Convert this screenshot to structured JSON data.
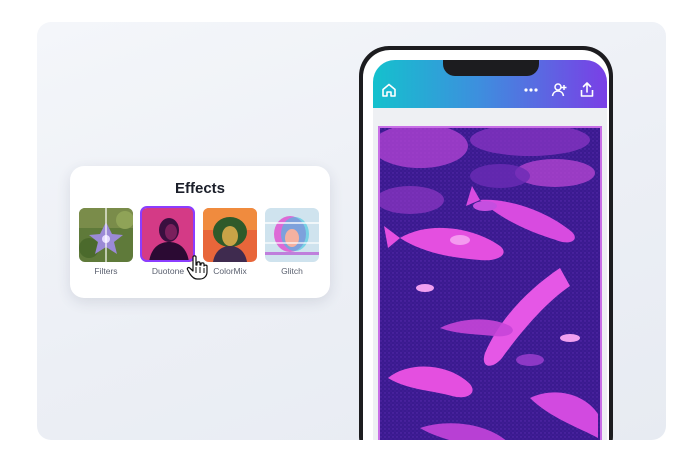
{
  "effects": {
    "title": "Effects",
    "items": [
      {
        "label": "Filters"
      },
      {
        "label": "Duotone",
        "selected": true
      },
      {
        "label": "ColorMix"
      },
      {
        "label": "Glitch"
      }
    ]
  },
  "phone": {
    "topbar_icons": [
      "home-icon",
      "more-icon",
      "collaborators-icon",
      "share-icon"
    ]
  },
  "colors": {
    "accent": "#8b3dff",
    "duotone_dark": "#3a1a8f",
    "duotone_light": "#e44fe0",
    "topbar_start": "#14c1cd",
    "topbar_end": "#7a3fe6"
  }
}
